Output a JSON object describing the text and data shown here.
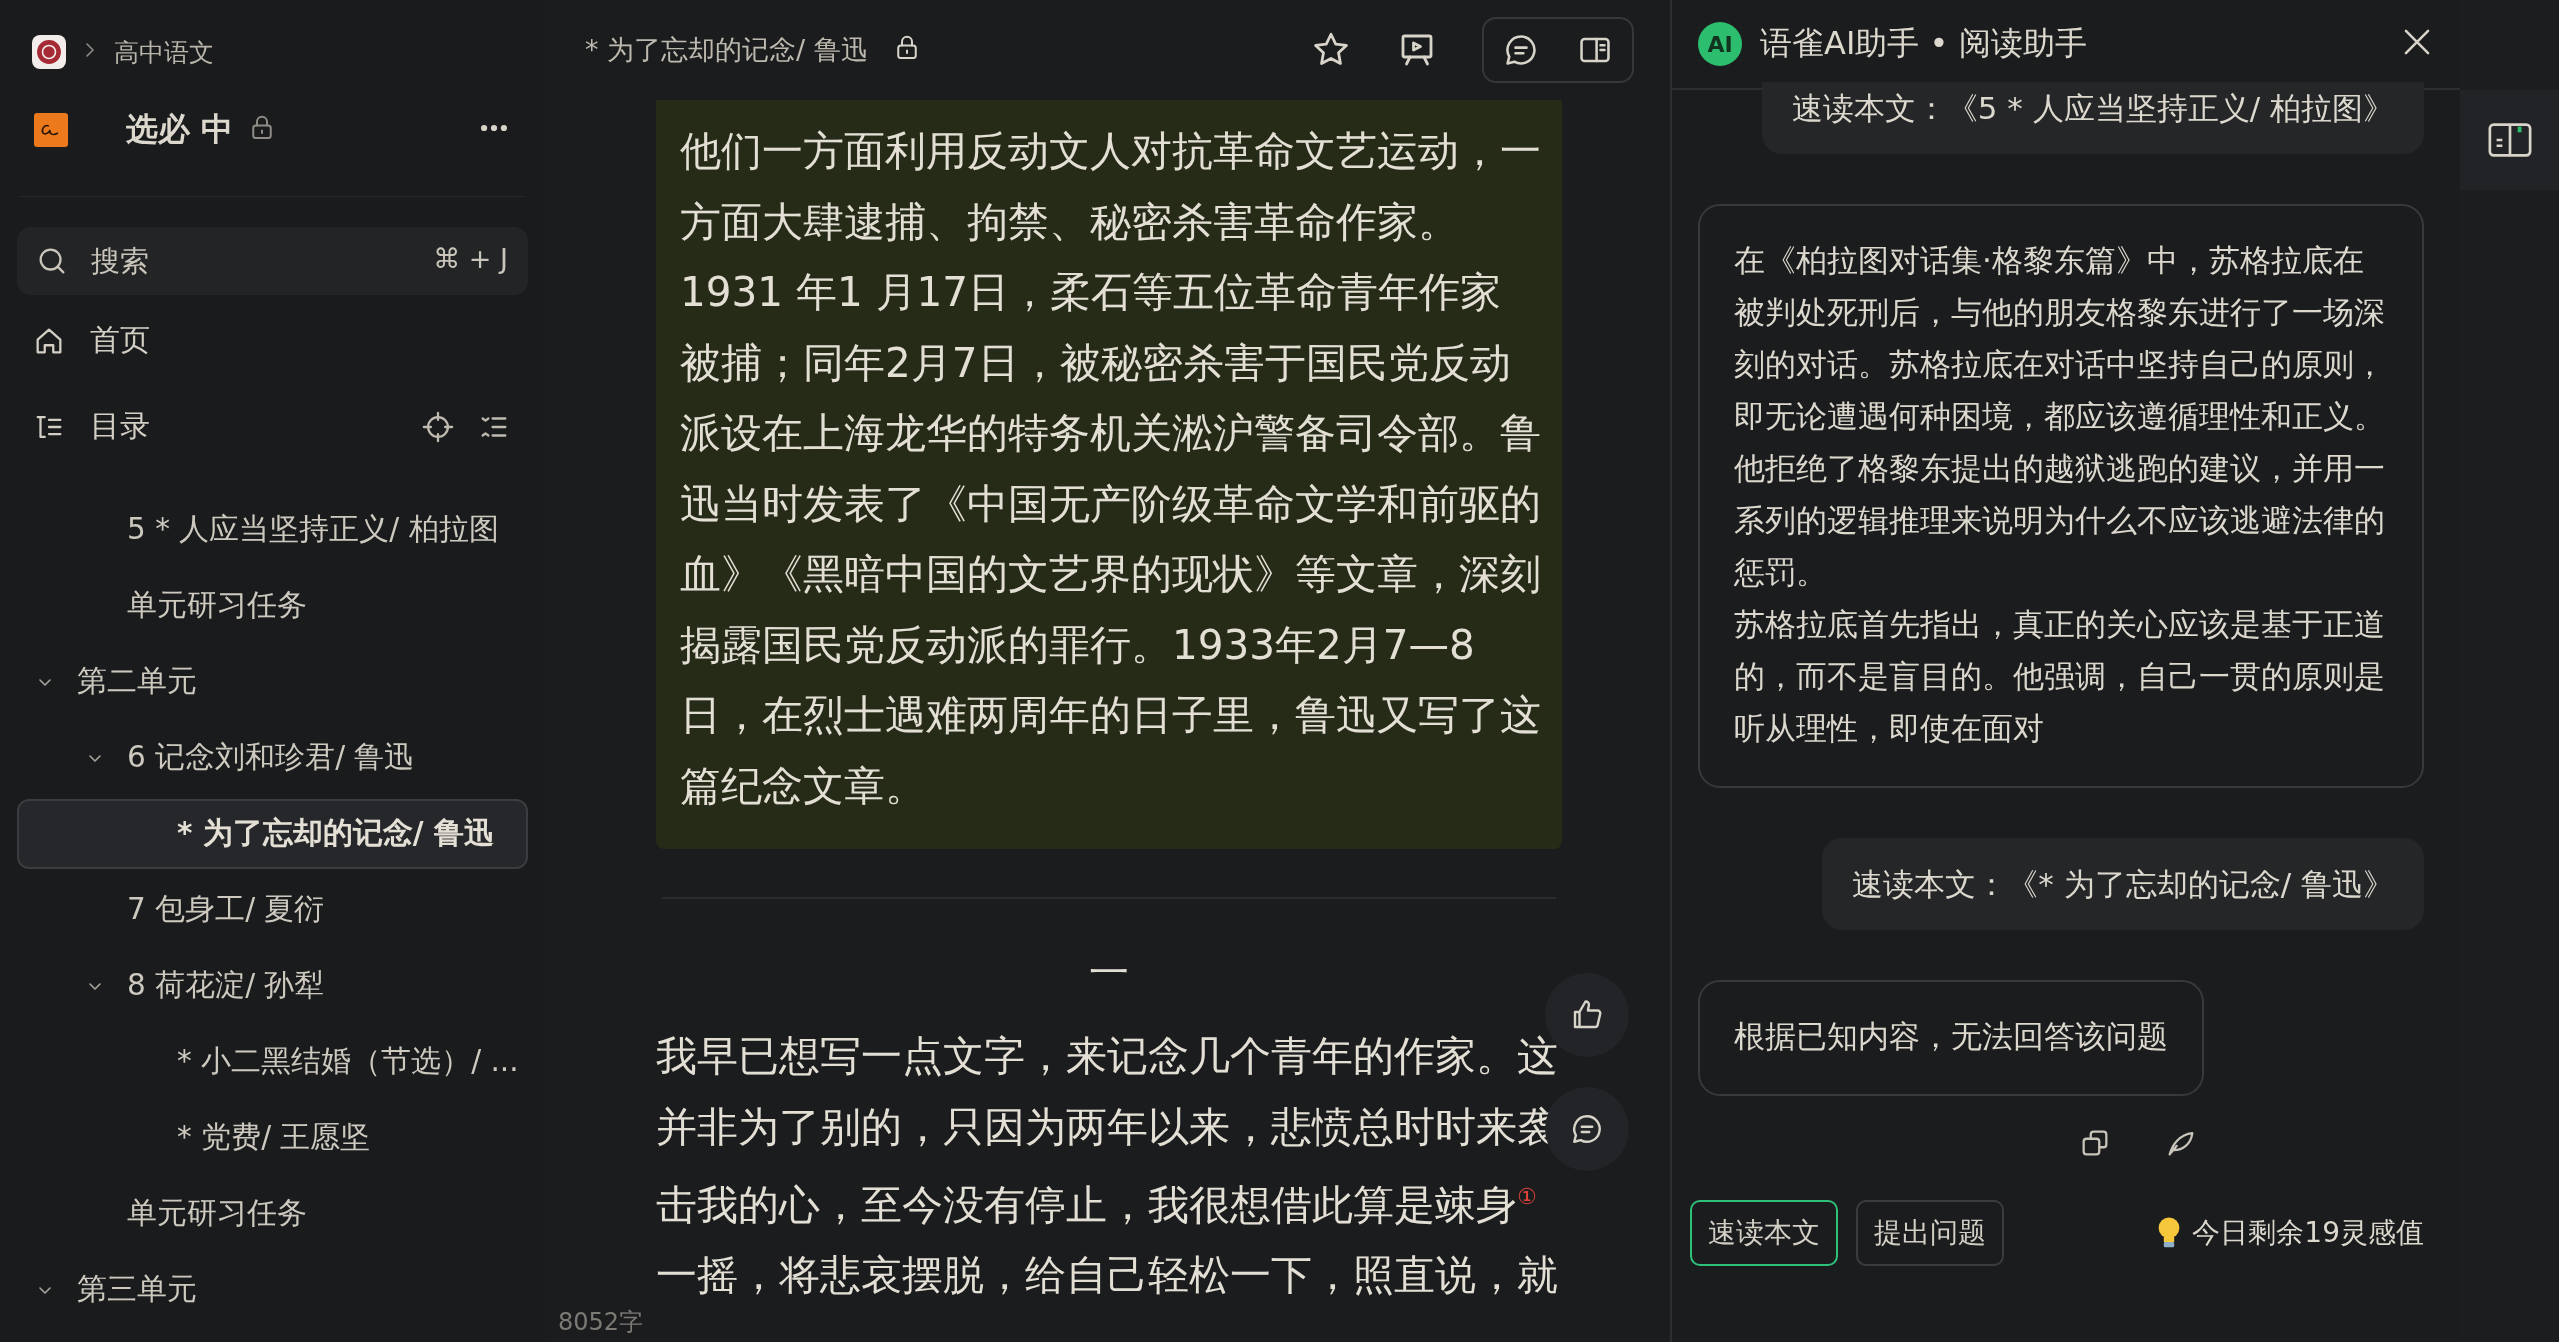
{
  "breadcrumb": {
    "label": "高中语文"
  },
  "book": {
    "title": "选必 中",
    "locked": true
  },
  "search": {
    "placeholder": "搜索",
    "shortcut": "⌘ + J"
  },
  "nav": [
    {
      "kind": "home",
      "label": "首页"
    },
    {
      "kind": "toc",
      "label": "目录"
    }
  ],
  "toc": [
    {
      "children": [
        {
          "label": "5 * 人应当坚持正义/ 柏拉图",
          "selected": false
        },
        {
          "label": "单元研习任务",
          "selected": false
        }
      ]
    },
    {
      "label": "第二单元",
      "selected": false,
      "expanded": true,
      "children": [
        {
          "label": "6 记念刘和珍君/ 鲁迅",
          "selected": false,
          "expanded": true,
          "children": [
            {
              "label": "* 为了忘却的记念/ 鲁迅",
              "selected": true
            }
          ]
        },
        {
          "label": "7 包身工/ 夏衍",
          "selected": false
        },
        {
          "label": "8 荷花淀/ 孙犁",
          "selected": false,
          "expanded": true,
          "children": [
            {
              "label": "* 小二黑结婚（节选）/ ...",
              "selected": false
            },
            {
              "label": "* 党费/ 王愿坚",
              "selected": false
            }
          ]
        },
        {
          "label": "单元研习任务",
          "selected": false
        }
      ]
    },
    {
      "label": "第三单元",
      "selected": false,
      "expanded": true
    }
  ],
  "document": {
    "title": "* 为了忘却的记念/ 鲁迅",
    "locked": true,
    "note_paragraphs": [
      "他们一方面利用反动文人对抗革命文艺运动，一方面大肆逮捕、拘禁、秘密杀害革命作家。",
      "1931 年1 月17日，柔石等五位革命青年作家被捕；同年2月7日，被秘密杀害于国民党反动派设在上海龙华的特务机关淞沪警备司令部。鲁迅当时发表了《中国无产阶级革命文学和前驱的血》《黑暗中国的文艺界的现状》等文章，深刻揭露国民党反动派的罪行。1933年2月7—8日，在烈士遇难两周年的日子里，鲁迅又写了这篇纪念文章。"
    ],
    "heading": "一",
    "paragraphs": [
      "我早已想写一点文字，来记念几个青年的作家。这并非为了别的，只因为两年以来，悲愤总时时来袭击我的心，至今没有停止，我很想借此算是竦身$^{①}$一摇，将悲哀摆脱，给自己轻松一下，照直说，就"
    ],
    "word_count": "8052字"
  },
  "assistant": {
    "logo": "AI",
    "title": "语雀AI助手 • 阅读助手",
    "messages": [
      {
        "kind": "user",
        "paragraphs": [
          "速读本文：《5 * 人应当坚持正义/ 柏拉图》"
        ]
      },
      {
        "kind": "assistant",
        "paragraphs": [
          "在《柏拉图对话集·格黎东篇》中，苏格拉底在被判处死刑后，与他的朋友格黎东进行了一场深刻的对话。苏格拉底在对话中坚持自己的原则，即无论遭遇何种困境，都应该遵循理性和正义。他拒绝了格黎东提出的越狱逃跑的建议，并用一系列的逻辑推理来说明为什么不应该逃避法律的惩罚。",
          "苏格拉底首先指出，真正的关心应该是基于正道的，而不是盲目的。他强调，自己一贯的原则是听从理性，即使在面对"
        ]
      },
      {
        "kind": "user",
        "paragraphs": [
          "速读本文：《* 为了忘却的记念/ 鲁迅》"
        ]
      },
      {
        "kind": "assistant",
        "paragraphs": [
          "根据已知内容，无法回答该问题"
        ]
      }
    ],
    "actions": [
      {
        "label": "速读本文",
        "selected": true
      },
      {
        "label": "提出问题",
        "selected": false
      }
    ],
    "quota": "今日剩余19灵感值"
  }
}
